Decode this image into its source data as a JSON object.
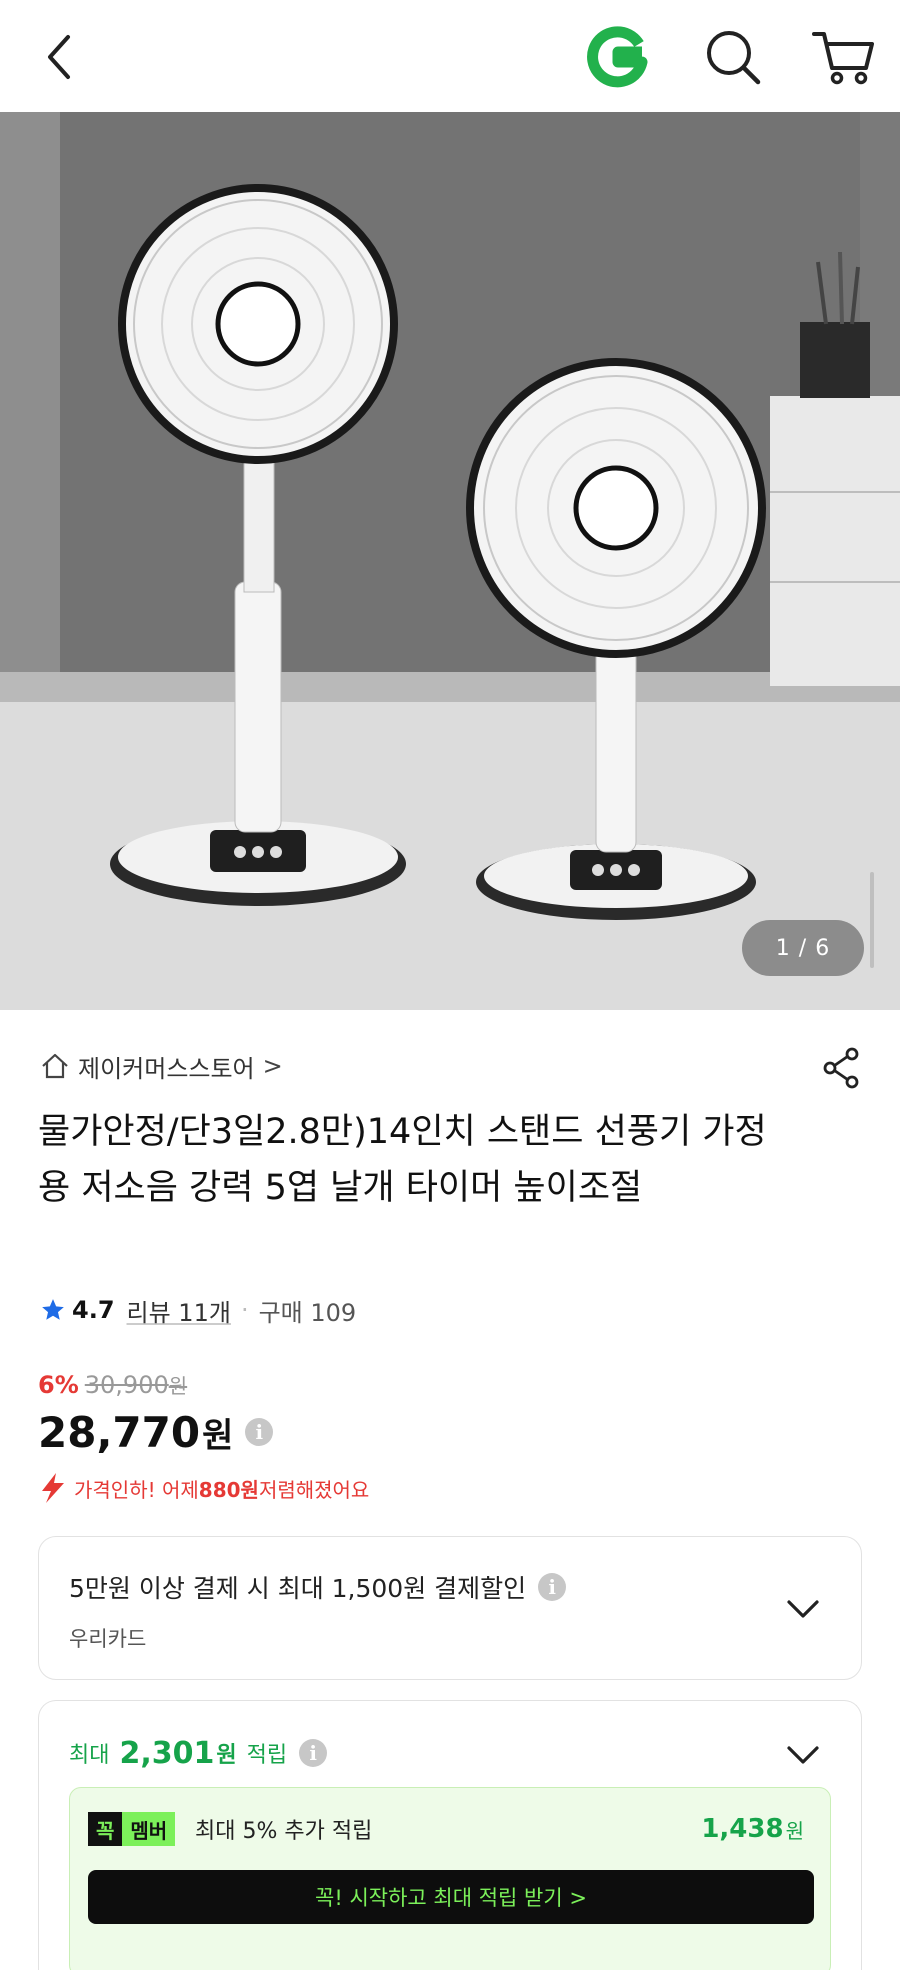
{
  "header": {
    "back_icon": "back-arrow-icon",
    "logo_icon": "g-logo-icon",
    "search_icon": "search-icon",
    "cart_icon": "cart-icon",
    "logo_color": "#22b14c"
  },
  "gallery": {
    "counter": "1 / 6"
  },
  "store": {
    "name": "제이커머스스토어",
    "arrow": ">"
  },
  "product": {
    "title": "물가안정/단3일2.8만)14인치 스탠드 선풍기 가정용 저소음 강력 5엽 날개 타이머 높이조절"
  },
  "rating": {
    "score": "4.7",
    "review": "리뷰 11개",
    "dot": "·",
    "purchase": "구매 109"
  },
  "price": {
    "discount": "6%",
    "original": "30,900",
    "original_won": "원",
    "amount": "28,770",
    "won": "원",
    "info": "i"
  },
  "price_drop": {
    "prefix": "가격인하! 어제 ",
    "amount": "880원",
    "suffix": " 저렴해졌어요",
    "color": "#e53935"
  },
  "card_discount": {
    "line1": "5만원 이상 결제 시 최대 1,500원 결제할인",
    "line2": "우리카드",
    "info": "i"
  },
  "points": {
    "prefix": "최대",
    "amount": "2,301",
    "won": "원",
    "label": "적립",
    "info": "i",
    "color": "#16a34a"
  },
  "membership": {
    "badge1": "꼭",
    "badge2": "멤버",
    "desc": "최대 5% 추가 적립",
    "points": "1,438",
    "points_won": "원",
    "cta": "꼭! 시작하고 최대 적립 받기  >",
    "accent": "#7cf05a"
  }
}
